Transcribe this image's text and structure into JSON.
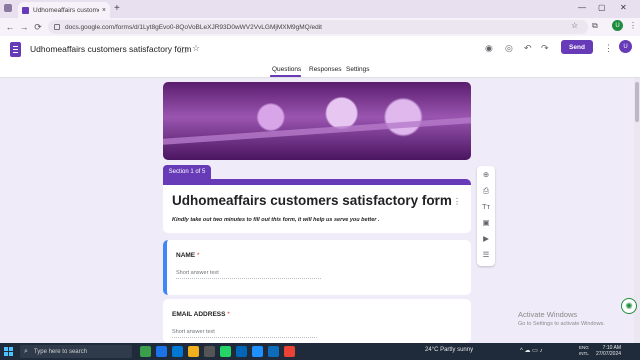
{
  "browser": {
    "tab_title": "Udhomeaffairs customers satisfa",
    "tab_close": "×",
    "new_tab": "+",
    "url": "docs.google.com/forms/d/1Lyt8gEvo0-8QoVoBLeXJR93D0wWV2VvLGMjMXM9gMQ/edit",
    "back": "←",
    "forward": "→",
    "reload": "⟳",
    "star": "☆",
    "extensions": "⧉",
    "profile_initial": "U",
    "menu": "⋮",
    "minimize": "—",
    "maximize": "▢",
    "close": "✕"
  },
  "forms_header": {
    "doc_title": "Udhomeaffairs customers satisfactory form",
    "folder_icon": "🗀",
    "star_icon": "☆",
    "palette_icon": "◉",
    "preview_icon": "◎",
    "undo_icon": "↶",
    "redo_icon": "↷",
    "send_label": "Send",
    "more_icon": "⋮",
    "avatar_initial": "U",
    "tabs": [
      "Questions",
      "Responses",
      "Settings"
    ],
    "active_tab": "Questions"
  },
  "form": {
    "section_label": "Section 1 of 5",
    "title": "Udhomeaffairs customers satisfactory form",
    "description": "Kindly take out two minutes to fill out this form, it will help us serve you better .",
    "collapse_icon": "⌃",
    "more_icon": "⋮",
    "questions": [
      {
        "label": "NAME",
        "required_mark": "*",
        "placeholder": "Short answer text"
      },
      {
        "label": "EMAIL ADDRESS",
        "required_mark": "*",
        "placeholder": "Short answer text"
      }
    ]
  },
  "side_toolbar": {
    "add_question_icon": "⊕",
    "import_questions_icon": "⎙",
    "add_title_icon": "Tт",
    "add_image_icon": "▣",
    "add_video_icon": "▶",
    "add_section_icon": "☰"
  },
  "overlay": {
    "activate_title": "Activate Windows",
    "activate_sub": "Go to Settings to activate Windows.",
    "gemini_icon": "✺"
  },
  "taskbar": {
    "search_placeholder": "Type here to search",
    "search_icon": "⌕",
    "weather": "24°C  Partly sunny",
    "tray_icons": "^  ☁  ▭  ♪",
    "lang_line1": "ENG",
    "lang_line2": "INTL",
    "time": "7:10 AM",
    "date": "27/07/2024",
    "app_colors": [
      "#3b9e4a",
      "#1a73e8",
      "#0078d4",
      "#f2b01e",
      "#555555",
      "#25d366",
      "#0067b8",
      "#1e90ff",
      "#0f6cbd",
      "#ea4335"
    ]
  },
  "colors": {
    "accent": "#673ab7",
    "page_bg": "#f0ebf8",
    "active_question_border": "#4285f4",
    "required": "#d93025"
  }
}
